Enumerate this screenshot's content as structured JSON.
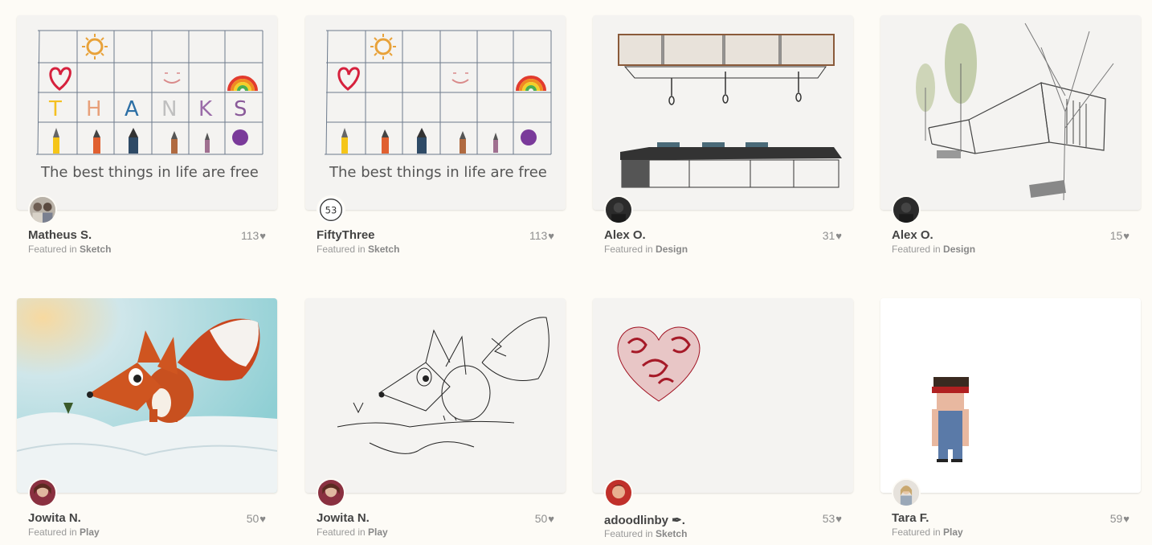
{
  "cards": [
    {
      "author": "Matheus S.",
      "featured_prefix": "Featured in",
      "category": "Sketch",
      "likes": "113",
      "caption": "The best things in life are free"
    },
    {
      "author": "FiftyThree",
      "featured_prefix": "Featured in",
      "category": "Sketch",
      "likes": "113",
      "caption": "The best things in life are free",
      "avatar_text": "53"
    },
    {
      "author": "Alex O.",
      "featured_prefix": "Featured in",
      "category": "Design",
      "likes": "31"
    },
    {
      "author": "Alex O.",
      "featured_prefix": "Featured in",
      "category": "Design",
      "likes": "15"
    },
    {
      "author": "Jowita N.",
      "featured_prefix": "Featured in",
      "category": "Play",
      "likes": "50"
    },
    {
      "author": "Jowita N.",
      "featured_prefix": "Featured in",
      "category": "Play",
      "likes": "50"
    },
    {
      "author": "adoodlinby ✒.",
      "featured_prefix": "Featured in",
      "category": "Sketch",
      "likes": "53"
    },
    {
      "author": "Tara F.",
      "featured_prefix": "Featured in",
      "category": "Play",
      "likes": "59"
    }
  ],
  "thanks_letters": [
    "T",
    "H",
    "A",
    "N",
    "K",
    "S"
  ],
  "heart_glyph": "heart-icon",
  "colors": {
    "background": "#fdfbf6",
    "thumb_bg": "#f4f3f1",
    "author": "#444444",
    "meta": "#999999"
  }
}
